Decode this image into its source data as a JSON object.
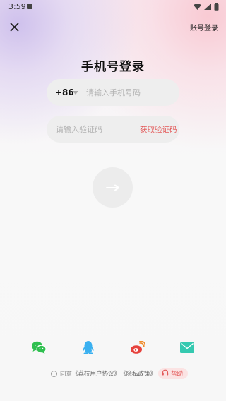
{
  "status_bar": {
    "time": "3:59"
  },
  "header": {
    "close_icon": "close-icon",
    "account_login": "账号登录"
  },
  "title": "手机号登录",
  "phone": {
    "country_code": "+86",
    "placeholder": "请输入手机号码",
    "value": ""
  },
  "code": {
    "placeholder": "请输入验证码",
    "value": "",
    "get_code": "获取验证码"
  },
  "submit": {
    "icon": "arrow-right-icon"
  },
  "social": [
    {
      "name": "wechat",
      "icon": "wechat-icon",
      "color": "#2fbf4f"
    },
    {
      "name": "qq",
      "icon": "qq-icon",
      "color": "#3ab0f0"
    },
    {
      "name": "weibo",
      "icon": "weibo-icon",
      "color": "#e6423c"
    },
    {
      "name": "email",
      "icon": "mail-icon",
      "color": "#35c9b0"
    }
  ],
  "agreement": {
    "prefix": "同意",
    "user_agreement": "《荔枝用户协议》",
    "privacy_policy": "《隐私政策》"
  },
  "help": {
    "label": "帮助"
  },
  "colors": {
    "accent": "#e35a5a",
    "field_bg": "#eeeeee"
  }
}
